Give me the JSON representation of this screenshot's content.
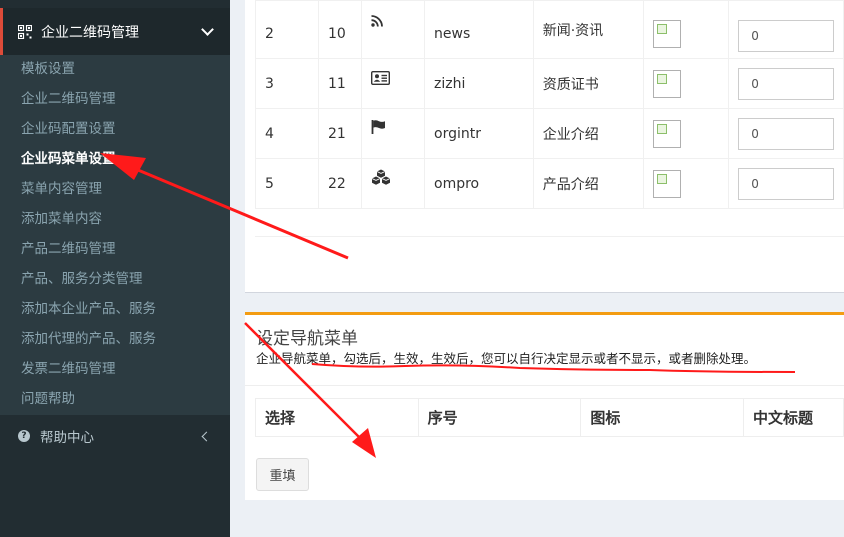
{
  "sidebar": {
    "header": {
      "label": "企业二维码管理"
    },
    "items": [
      {
        "label": "模板设置"
      },
      {
        "label": "企业二维码管理"
      },
      {
        "label": "企业码配置设置"
      },
      {
        "label": "企业码菜单设置"
      },
      {
        "label": "菜单内容管理"
      },
      {
        "label": "添加菜单内容"
      },
      {
        "label": "产品二维码管理"
      },
      {
        "label": "产品、服务分类管理"
      },
      {
        "label": "添加本企业产品、服务"
      },
      {
        "label": "添加代理的产品、服务"
      },
      {
        "label": "发票二维码管理"
      },
      {
        "label": "问题帮助"
      }
    ],
    "help": {
      "label": "帮助中心"
    }
  },
  "menu_table": {
    "rows": [
      {
        "index": "2",
        "id": "10",
        "icon": "rss-icon",
        "code": "news",
        "name": "新闻·资讯",
        "sort": "0"
      },
      {
        "index": "3",
        "id": "11",
        "icon": "id-card-icon",
        "code": "zizhi",
        "name": "资质证书",
        "sort": "0"
      },
      {
        "index": "4",
        "id": "21",
        "icon": "flag-icon",
        "code": "orgintr",
        "name": "企业介绍",
        "sort": "0"
      },
      {
        "index": "5",
        "id": "22",
        "icon": "cubes-icon",
        "code": "ompro",
        "name": "产品介绍",
        "sort": "0"
      }
    ]
  },
  "nav_section": {
    "title": "设定导航菜单",
    "description": "企业导航菜单，勾选后，生效，生效后，您可以自行决定显示或者不显示，或者删除处理。",
    "columns": [
      "选择",
      "序号",
      "图标",
      "中文标题"
    ],
    "reset_label": "重填"
  },
  "colors": {
    "accent": "#f39c12",
    "sidebar_bg": "#222d32",
    "active_border": "#dd4b39",
    "annotation": "#ff1a1a"
  }
}
